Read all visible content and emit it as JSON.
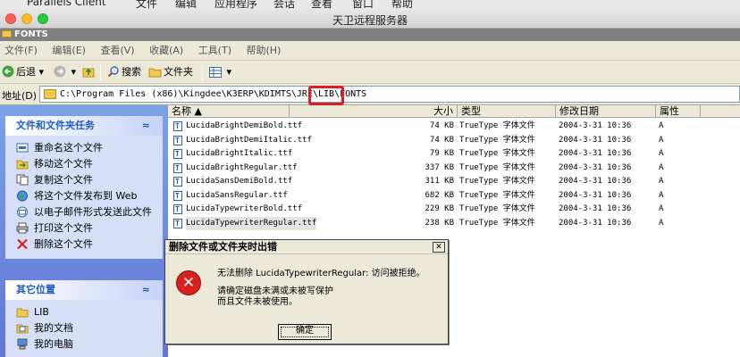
{
  "mac_menu": [
    "Parallels Client",
    "文件",
    "编辑",
    "应用程序",
    "会话",
    "查看",
    "窗口",
    "帮助"
  ],
  "window": {
    "title": "天卫远程服务器",
    "inner_title": "FONTS"
  },
  "menu": [
    "文件(F)",
    "编辑(E)",
    "查看(V)",
    "收藏(A)",
    "工具(T)",
    "帮助(H)"
  ],
  "toolbar": {
    "back": "后退",
    "search": "搜索",
    "folders": "文件夹"
  },
  "address": {
    "label": "地址(D)",
    "path_prefix": "C:\\Program Files (x86)\\Kingdee\\K3ERP\\KDIMTS\\JRE\\LIB\\",
    "path_last": "FONTS"
  },
  "tasks": {
    "title": "文件和文件夹任务",
    "items": [
      "重命名这个文件",
      "移动这个文件",
      "复制这个文件",
      "将这个文件发布到 Web",
      "以电子邮件形式发送此文件",
      "打印这个文件",
      "删除这个文件"
    ]
  },
  "places": {
    "title": "其它位置",
    "items": [
      "LIB",
      "我的文档",
      "我的电脑"
    ]
  },
  "columns": {
    "name": "名称 ▲",
    "size": "大小",
    "type": "类型",
    "date": "修改日期",
    "attr": "属性"
  },
  "files": [
    {
      "name": "LucidaBrightDemiBold.ttf",
      "size": "74 KB",
      "type": "TrueType 字体文件",
      "date": "2004-3-31 10:36",
      "attr": "A"
    },
    {
      "name": "LucidaBrightDemiItalic.ttf",
      "size": "74 KB",
      "type": "TrueType 字体文件",
      "date": "2004-3-31 10:36",
      "attr": "A"
    },
    {
      "name": "LucidaBrightItalic.ttf",
      "size": "79 KB",
      "type": "TrueType 字体文件",
      "date": "2004-3-31 10:36",
      "attr": "A"
    },
    {
      "name": "LucidaBrightRegular.ttf",
      "size": "337 KB",
      "type": "TrueType 字体文件",
      "date": "2004-3-31 10:36",
      "attr": "A"
    },
    {
      "name": "LucidaSansDemiBold.ttf",
      "size": "311 KB",
      "type": "TrueType 字体文件",
      "date": "2004-3-31 10:36",
      "attr": "A"
    },
    {
      "name": "LucidaSansRegular.ttf",
      "size": "682 KB",
      "type": "TrueType 字体文件",
      "date": "2004-3-31 10:36",
      "attr": "A"
    },
    {
      "name": "LucidaTypewriterBold.ttf",
      "size": "229 KB",
      "type": "TrueType 字体文件",
      "date": "2004-3-31 10:36",
      "attr": "A"
    },
    {
      "name": "LucidaTypewriterRegular.ttf",
      "size": "238 KB",
      "type": "TrueType 字体文件",
      "date": "2004-3-31 10:36",
      "attr": "A"
    }
  ],
  "dialog": {
    "title": "删除文件或文件夹时出错",
    "message": "无法删除 LucidaTypewriterRegular: 访问被拒绝。",
    "detail_line1": "请确定磁盘未满或未被写保护",
    "detail_line2": "而且文件未被使用。",
    "ok": "确定",
    "close": "✕"
  }
}
